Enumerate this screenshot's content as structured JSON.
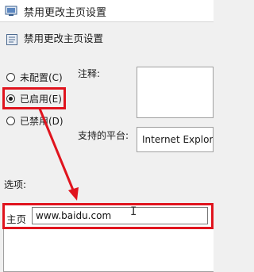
{
  "window": {
    "title": "禁用更改主页设置"
  },
  "header": {
    "title": "禁用更改主页设置"
  },
  "state_options": [
    {
      "label": "未配置(C)",
      "checked": false,
      "underline_key": "C"
    },
    {
      "label": "已启用(E)",
      "checked": true,
      "underline_key": "E"
    },
    {
      "label": "已禁用(D)",
      "checked": false,
      "underline_key": "D"
    }
  ],
  "comment": {
    "label": "注释:",
    "value": ""
  },
  "platform": {
    "label": "支持的平台:",
    "value": "Internet Explore"
  },
  "options": {
    "label": "选项:",
    "homepage_label": "主页",
    "homepage_value": "www.baidu.com"
  },
  "colors": {
    "highlight": "#e0141e"
  }
}
